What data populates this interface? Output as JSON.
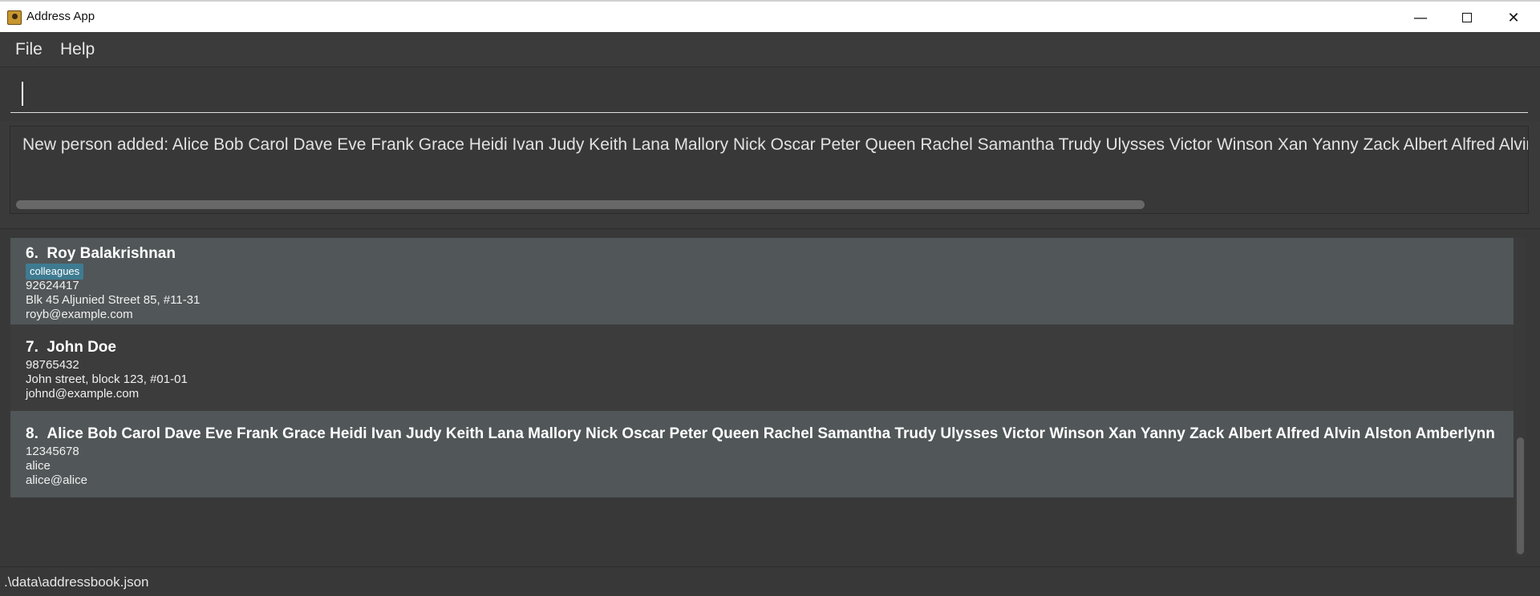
{
  "window": {
    "title": "Address App",
    "minimize_glyph": "—",
    "close_glyph": "✕"
  },
  "menu": {
    "file_label": "File",
    "help_label": "Help"
  },
  "command": {
    "value": "",
    "placeholder": ""
  },
  "result": {
    "message": "New person added: Alice Bob Carol Dave Eve Frank Grace Heidi Ivan Judy Keith Lana Mallory Nick Oscar Peter Queen Rachel Samantha Trudy Ulysses Victor Winson Xan Yanny Zack Albert Alfred Alvin Alston"
  },
  "persons": [
    {
      "index": "6.",
      "name": "Roy Balakrishnan",
      "tags": [
        "colleagues"
      ],
      "phone": "92624417",
      "address": "Blk 45 Aljunied Street 85, #11-31",
      "email": "royb@example.com"
    },
    {
      "index": "7.",
      "name": "John Doe",
      "tags": [],
      "phone": "98765432",
      "address": "John street, block 123, #01-01",
      "email": "johnd@example.com"
    },
    {
      "index": "8.",
      "name": "Alice Bob Carol Dave Eve Frank Grace Heidi Ivan Judy Keith Lana Mallory Nick Oscar Peter Queen Rachel Samantha Trudy Ulysses Victor Winson Xan Yanny Zack Albert Alfred Alvin Alston Amberlynn",
      "tags": [],
      "phone": "12345678",
      "address": "alice",
      "email": "alice@alice"
    }
  ],
  "status": {
    "file_path": ".\\data\\addressbook.json"
  },
  "colors": {
    "background": "#3a3a3a",
    "card_alt": "#515658",
    "tag": "#3e7b91"
  }
}
